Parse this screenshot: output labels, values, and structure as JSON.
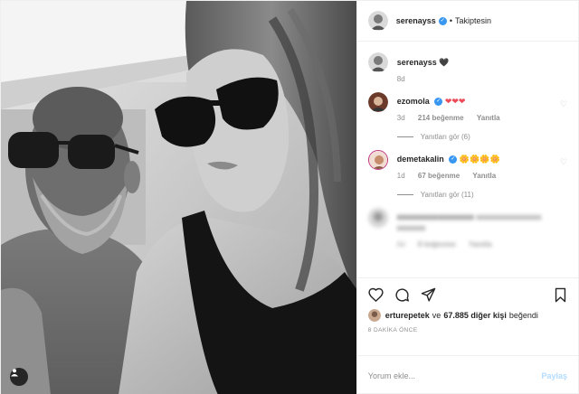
{
  "header": {
    "username": "serenayss",
    "separator": "•",
    "follow_status": "Takiptesin"
  },
  "caption": {
    "username": "serenayss",
    "emoji": "🖤",
    "age": "8d"
  },
  "comments": [
    {
      "username": "ezomola",
      "text": "❤❤❤",
      "age": "3d",
      "likes": "214 beğenme",
      "reply": "Yanıtla",
      "view_replies": "Yanıtları gör (6)"
    },
    {
      "username": "demetakalin",
      "text": "🌼🌼🌼🌼",
      "age": "1d",
      "likes": "67 beğenme",
      "reply": "Yanıtla",
      "view_replies": "Yanıtları gör (11)"
    },
    {
      "username": "xxxxxxxxxxxxxxxxx",
      "text": "xxxxxxxxxxxxxxxx xxxxxxx",
      "age": "6d",
      "likes": "8 beğenme",
      "reply": "Yanıtla"
    }
  ],
  "likes": {
    "username": "erturepetek",
    "rest": "ve",
    "count": "67.885 diğer kişi",
    "suffix": "beğendi"
  },
  "timestamp": "8 DAKİKA ÖNCE",
  "add_comment": {
    "placeholder": "Yorum ekle...",
    "post_label": "Paylaş"
  },
  "colors": {
    "verified": "#3897f0",
    "heart": "#ed4956",
    "muted": "#8e8e8e",
    "post_disabled": "#b3dbff"
  }
}
